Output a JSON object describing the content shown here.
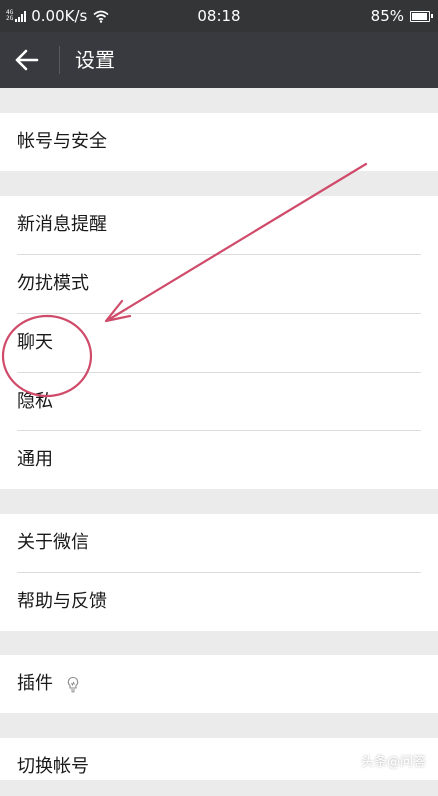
{
  "status_bar": {
    "network_top": "4G",
    "network_bottom": "2G",
    "speed": "0.00K/s",
    "time": "08:18",
    "battery": "85%",
    "battery_level": 0.85
  },
  "header": {
    "title": "设置"
  },
  "settings": {
    "account_security": "帐号与安全",
    "new_message_alerts": "新消息提醒",
    "do_not_disturb": "勿扰模式",
    "chat": "聊天",
    "privacy": "隐私",
    "general": "通用",
    "about_wechat": "关于微信",
    "help_feedback": "帮助与反馈",
    "plugins": "插件",
    "switch_account": "切换帐号"
  },
  "annotation_color": "#d04a6a",
  "watermark": {
    "text": "头条@问答"
  }
}
